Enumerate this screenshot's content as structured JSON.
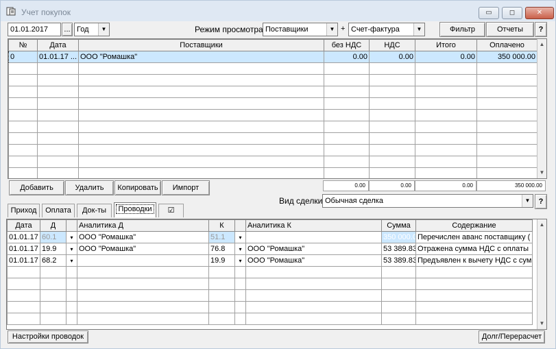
{
  "window": {
    "title": "Учет покупок",
    "min": "▭",
    "max": "◻",
    "close": "✕"
  },
  "toolbar": {
    "date": "01.01.2017",
    "date_btn": "...",
    "period": "Год",
    "mode_label": "Режим просмотра:",
    "mode_value": "Поставщики",
    "plus": "+",
    "doc_value": "Счет-фактура",
    "filter": "Фильтр",
    "reports": "Отчеты",
    "help": "?"
  },
  "top_table": {
    "columns": [
      "№",
      "Дата",
      "Поставщики",
      "без НДС",
      "НДС",
      "Итого",
      "Оплачено"
    ],
    "rows": [
      [
        "0",
        "01.01.17 ...",
        "ООО \"Ромашка\"",
        "0.00",
        "0.00",
        "0.00",
        "350 000.00"
      ]
    ],
    "totals": [
      "0.00",
      "0.00",
      "0.00",
      "350 000.00"
    ]
  },
  "actions": {
    "add": "Добавить",
    "delete": "Удалить",
    "copy": "Копировать",
    "import": "Импорт"
  },
  "deal": {
    "label": "Вид сделки",
    "value": "Обычная сделка",
    "help": "?"
  },
  "tabs": [
    "Приход",
    "Оплата",
    "Док-ты",
    "Проводки",
    "☑"
  ],
  "entries": {
    "columns": [
      "Дата",
      "Д",
      "",
      "Аналитика Д",
      "К",
      "",
      "Аналитика К",
      "Сумма",
      "Содержание"
    ],
    "rows": [
      [
        "01.01.17",
        "60.1",
        "▾",
        "ООО \"Ромашка\"",
        "51.1",
        "▾",
        "",
        "350 000.00",
        "Перечислен аванс поставщику ("
      ],
      [
        "01.01.17",
        "19.9",
        "▾",
        "ООО \"Ромашка\"",
        "76.8",
        "▾",
        "ООО \"Ромашка\"",
        "53 389.83",
        "Отражена сумма НДС с оплаты"
      ],
      [
        "01.01.17",
        "68.2",
        "▾",
        "",
        "19.9",
        "▾",
        "ООО \"Ромашка\"",
        "53 389.83",
        "Предъявлен к вычету НДС с сум"
      ]
    ]
  },
  "bottom": {
    "settings": "Настройки проводок",
    "debt": "Долг/Перерасчет"
  },
  "scroll": {
    "up": "▲",
    "down": "▼",
    "dd": "▼"
  }
}
